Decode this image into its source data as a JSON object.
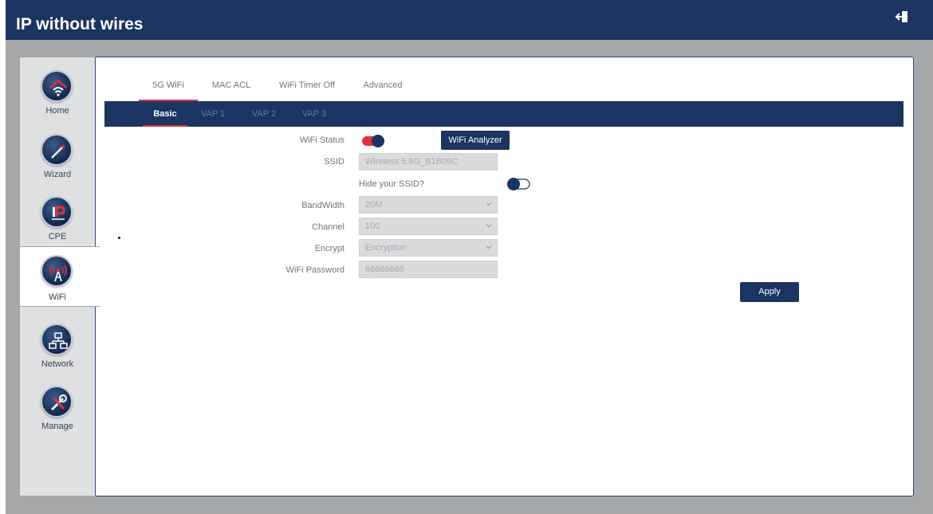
{
  "header": {
    "title": "IP without wires",
    "logout_icon": "logout-icon"
  },
  "sidebar": {
    "items": [
      {
        "label": "Home",
        "icon": "home-wifi-icon"
      },
      {
        "label": "Wizard",
        "icon": "wand-icon"
      },
      {
        "label": "CPE",
        "icon": "ip-mitter-icon"
      },
      {
        "label": "WiFi",
        "icon": "wifi-tower-icon",
        "active": true
      },
      {
        "label": "Network",
        "icon": "network-icon"
      },
      {
        "label": "Manage",
        "icon": "tools-icon"
      }
    ]
  },
  "tabs": [
    "5G WiFi",
    "MAC ACL",
    "WiFi Timer Off",
    "Advanced"
  ],
  "subtabs": [
    "Basic",
    "VAP 1",
    "VAP 2",
    "VAP 3"
  ],
  "form": {
    "wifi_status_label": "WiFi Status",
    "wifi_status_on": true,
    "analyzer_button": "WiFi Analyzer",
    "ssid_label": "SSID",
    "ssid_value": "Wireless 5.8G_B1B09C",
    "hide_ssid_label": "Hide your SSID?",
    "hide_ssid_on": false,
    "bandwidth_label": "BandWidth",
    "bandwidth_value": "20M",
    "channel_label": "Channel",
    "channel_value": "100",
    "encrypt_label": "Encrypt",
    "encrypt_value": "Encryption",
    "password_label": "WiFi Password",
    "password_value": "66666666",
    "apply_button": "Apply"
  },
  "colors": {
    "header_bg": "#1b3461",
    "accent_red": "#e0303a",
    "frame_gray": "#a6a7a9"
  }
}
